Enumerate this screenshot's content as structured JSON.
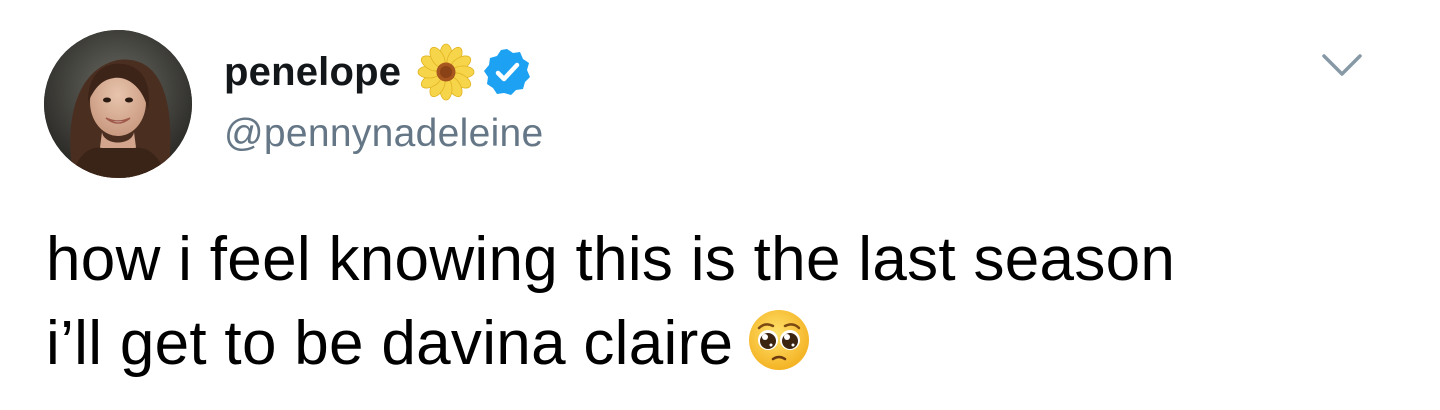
{
  "author": {
    "display_name": "penelope",
    "handle": "@pennynadeleine",
    "name_emoji": "sunflower-icon",
    "verified": true
  },
  "tweet": {
    "line1": "how i feel knowing this is the last season",
    "line2": "i’ll get to be davina claire",
    "trailing_emoji": "pleading-face-icon"
  },
  "colors": {
    "name": "#14171a",
    "handle": "#657786",
    "verified_badge": "#1da1f2",
    "caret": "#8899a6"
  }
}
